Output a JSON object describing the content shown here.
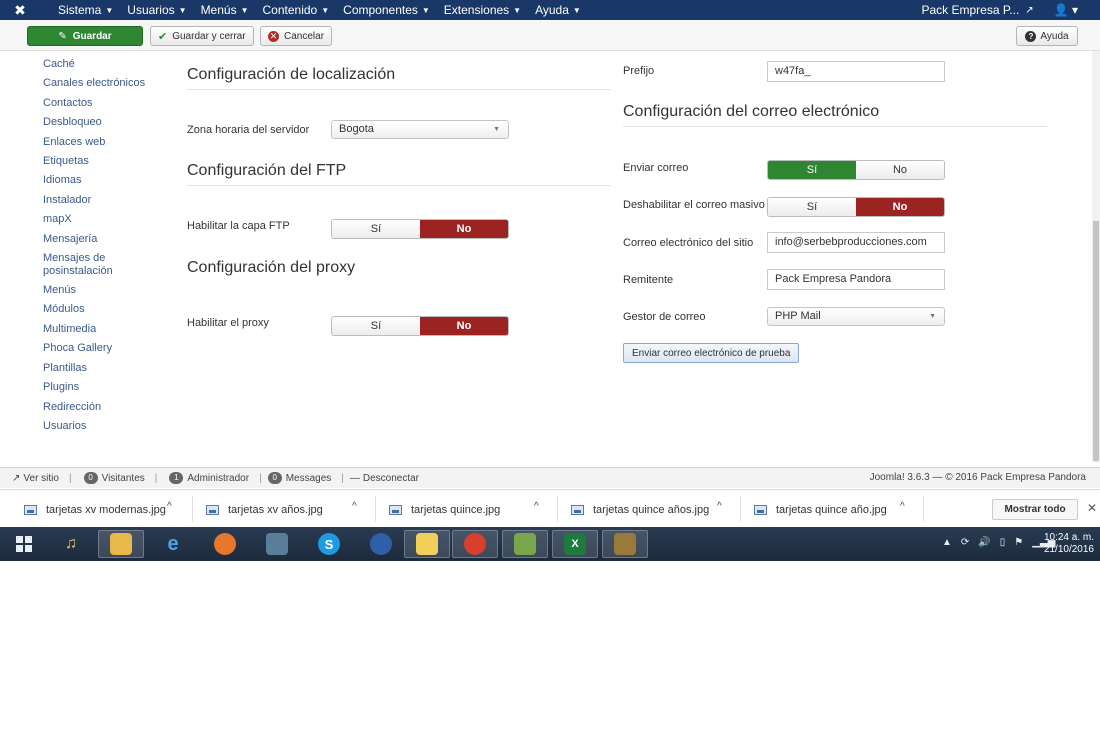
{
  "navbar": {
    "menu": [
      "Sistema",
      "Usuarios",
      "Menús",
      "Contenido",
      "Componentes",
      "Extensiones",
      "Ayuda"
    ],
    "site_name": "Pack Empresa P..."
  },
  "toolbar": {
    "save": "Guardar",
    "save_close": "Guardar y cerrar",
    "cancel": "Cancelar",
    "help": "Ayuda"
  },
  "sidebar": {
    "items": [
      "Caché",
      "Canales electrónicos",
      "Contactos",
      "Desbloqueo",
      "Enlaces web",
      "Etiquetas",
      "Idiomas",
      "Instalador",
      "mapX",
      "Mensajería",
      "Mensajes de posinstalación",
      "Menús",
      "Módulos",
      "Multimedia",
      "Phoca Gallery",
      "Plantillas",
      "Plugins",
      "Redirección",
      "Usuarios"
    ]
  },
  "localization": {
    "title": "Configuración de localización",
    "timezone_label": "Zona horaria del servidor",
    "timezone_value": "Bogota"
  },
  "ftp": {
    "title": "Configuración del FTP",
    "enable_label": "Habilitar la capa FTP",
    "yes": "Sí",
    "no": "No",
    "selected": "No"
  },
  "proxy": {
    "title": "Configuración del proxy",
    "enable_label": "Habilitar el proxy",
    "yes": "Sí",
    "no": "No",
    "selected": "No"
  },
  "database": {
    "prefix_label": "Prefijo",
    "prefix_value": "w47fa_"
  },
  "mail": {
    "title": "Configuración del correo electrónico",
    "send_label": "Enviar correo",
    "send_yes": "Sí",
    "send_no": "No",
    "send_selected": "Sí",
    "mass_label": "Deshabilitar el correo masivo",
    "mass_yes": "Sí",
    "mass_no": "No",
    "mass_selected": "No",
    "from_email_label": "Correo electrónico del sitio",
    "from_email_value": "info@serbebproducciones.com",
    "from_name_label": "Remitente",
    "from_name_value": "Pack Empresa Pandora",
    "mailer_label": "Gestor de correo",
    "mailer_value": "PHP Mail",
    "test_button": "Enviar correo electrónico de prueba"
  },
  "statusbar": {
    "view_site": "Ver sitio",
    "visitors_count": "0",
    "visitors_label": "Visitantes",
    "admins_count": "1",
    "admins_label": "Administrador",
    "messages_count": "0",
    "messages_label": "Messages",
    "logout": "Desconectar",
    "version": "Joomla! 3.6.3 — © 2016 Pack Empresa Pandora"
  },
  "downloads": {
    "files": [
      "tarjetas xv modernas.jpg",
      "tarjetas xv años.jpg",
      "tarjetas quince.jpg",
      "tarjetas quince años.jpg",
      "tarjetas quince año.jpg"
    ],
    "show_all": "Mostrar todo"
  },
  "taskbar": {
    "time": "10:24 a. m.",
    "date": "21/10/2016"
  },
  "colors": {
    "navbar": "#1a3867",
    "save_green": "#2f8632",
    "toggle_red": "#9b2422"
  }
}
